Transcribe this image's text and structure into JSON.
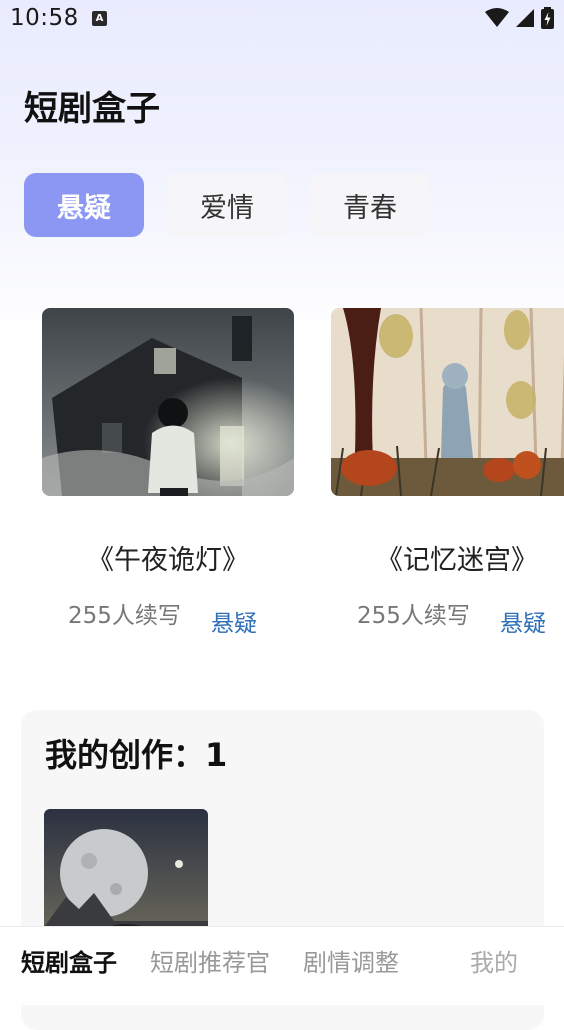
{
  "status_bar": {
    "time": "10:58",
    "notification_icon": "a-letter-icon",
    "icons": [
      "wifi-icon",
      "signal-icon",
      "battery-charging-icon"
    ]
  },
  "app": {
    "title": "短剧盒子"
  },
  "tabs": [
    {
      "label": "悬疑",
      "active": true
    },
    {
      "label": "爱情",
      "active": false
    },
    {
      "label": "青春",
      "active": false
    }
  ],
  "cards": [
    {
      "title": "《午夜诡灯》",
      "readers": "255人续写",
      "tag": "悬疑",
      "image": "haunted-house-illustration"
    },
    {
      "title": "《记忆迷宫》",
      "readers": "255人续写",
      "tag": "悬疑",
      "image": "ghost-forest-illustration"
    }
  ],
  "my_creations": {
    "title": "我的创作：1",
    "thumb_image": "moon-landscape-illustration"
  },
  "bottom_nav": [
    {
      "label": "短剧盒子",
      "active": true
    },
    {
      "label": "短剧推荐官",
      "active": false
    },
    {
      "label": "剧情调整",
      "active": false
    },
    {
      "label": "我的",
      "active": false
    }
  ],
  "colors": {
    "accent": "#8c97f3",
    "tag_blue": "#2f6fb8",
    "header_gradient": "#e9ecfe"
  }
}
